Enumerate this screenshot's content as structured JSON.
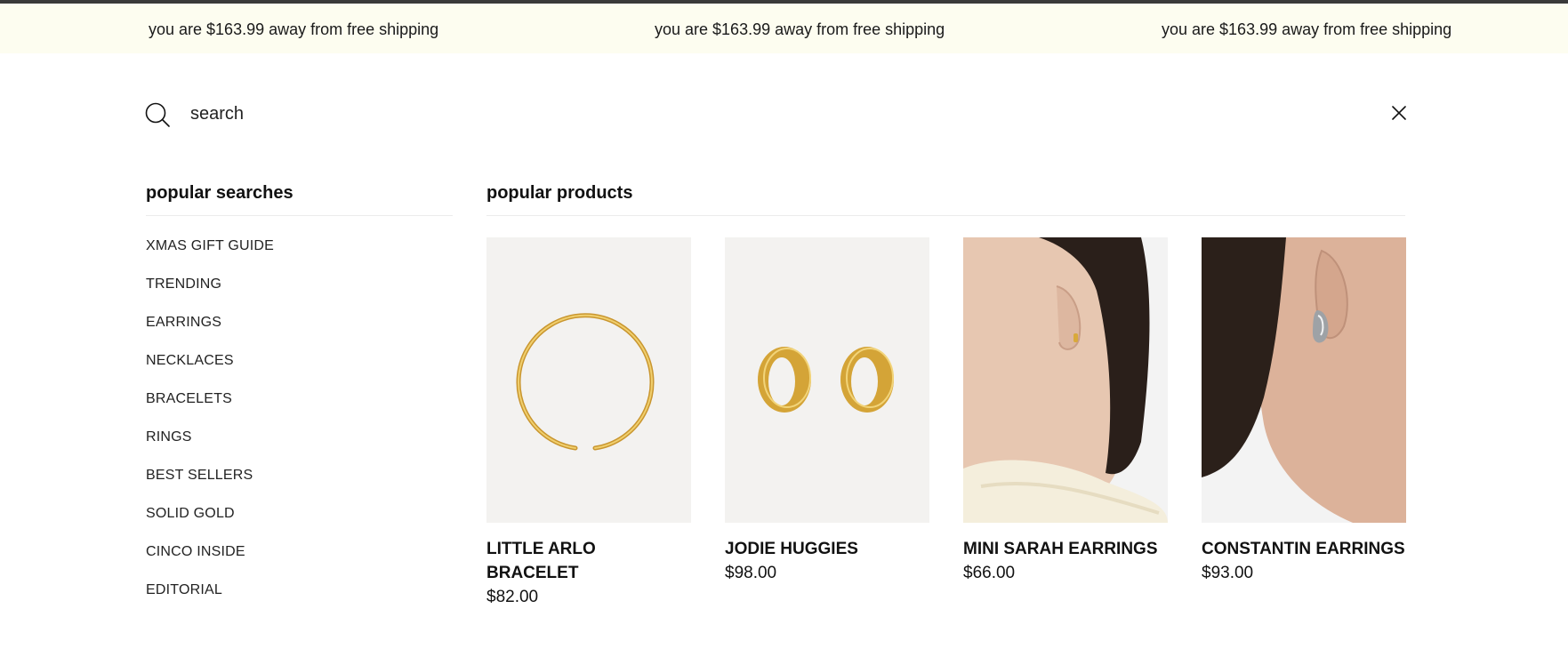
{
  "announcement": {
    "messages": [
      "you are $163.99 away from free shipping",
      "you are $163.99 away from free shipping",
      "you are $163.99 away from free shipping"
    ]
  },
  "search": {
    "placeholder": "search",
    "icon": "search-icon",
    "close_icon": "close-icon"
  },
  "popular_searches": {
    "heading": "popular searches",
    "items": [
      "XMAS GIFT GUIDE",
      "TRENDING",
      "EARRINGS",
      "NECKLACES",
      "BRACELETS",
      "RINGS",
      "BEST SELLERS",
      "SOLID GOLD",
      "CINCO INSIDE",
      "EDITORIAL"
    ]
  },
  "popular_products": {
    "heading": "popular products",
    "items": [
      {
        "name": "LITTLE ARLO BRACELET",
        "price": "$82.00"
      },
      {
        "name": "JODIE HUGGIES",
        "price": "$98.00"
      },
      {
        "name": "MINI SARAH EARRINGS",
        "price": "$66.00"
      },
      {
        "name": "CONSTANTIN EARRINGS",
        "price": "$93.00"
      }
    ]
  },
  "colors": {
    "announcement_bg": "#fdfdf0",
    "image_bg": "#f3f2f0",
    "gold": "#d9a93a",
    "text": "#111111"
  }
}
